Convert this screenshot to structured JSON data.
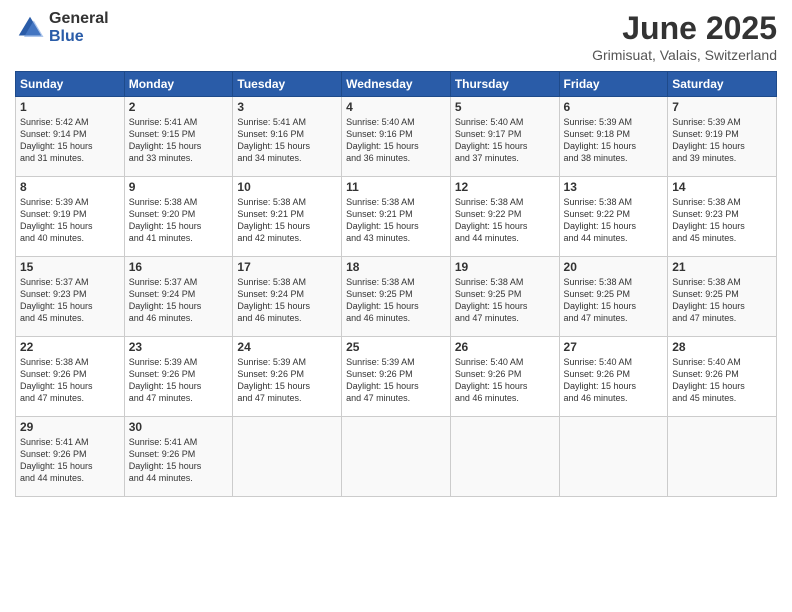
{
  "logo": {
    "general": "General",
    "blue": "Blue"
  },
  "title": {
    "month": "June 2025",
    "location": "Grimisuat, Valais, Switzerland"
  },
  "days_of_week": [
    "Sunday",
    "Monday",
    "Tuesday",
    "Wednesday",
    "Thursday",
    "Friday",
    "Saturday"
  ],
  "weeks": [
    [
      {
        "day": "1",
        "sunrise": "5:42 AM",
        "sunset": "9:14 PM",
        "daylight": "15 hours and 31 minutes."
      },
      {
        "day": "2",
        "sunrise": "5:41 AM",
        "sunset": "9:15 PM",
        "daylight": "15 hours and 33 minutes."
      },
      {
        "day": "3",
        "sunrise": "5:41 AM",
        "sunset": "9:16 PM",
        "daylight": "15 hours and 34 minutes."
      },
      {
        "day": "4",
        "sunrise": "5:40 AM",
        "sunset": "9:16 PM",
        "daylight": "15 hours and 36 minutes."
      },
      {
        "day": "5",
        "sunrise": "5:40 AM",
        "sunset": "9:17 PM",
        "daylight": "15 hours and 37 minutes."
      },
      {
        "day": "6",
        "sunrise": "5:39 AM",
        "sunset": "9:18 PM",
        "daylight": "15 hours and 38 minutes."
      },
      {
        "day": "7",
        "sunrise": "5:39 AM",
        "sunset": "9:19 PM",
        "daylight": "15 hours and 39 minutes."
      }
    ],
    [
      {
        "day": "8",
        "sunrise": "5:39 AM",
        "sunset": "9:19 PM",
        "daylight": "15 hours and 40 minutes."
      },
      {
        "day": "9",
        "sunrise": "5:38 AM",
        "sunset": "9:20 PM",
        "daylight": "15 hours and 41 minutes."
      },
      {
        "day": "10",
        "sunrise": "5:38 AM",
        "sunset": "9:21 PM",
        "daylight": "15 hours and 42 minutes."
      },
      {
        "day": "11",
        "sunrise": "5:38 AM",
        "sunset": "9:21 PM",
        "daylight": "15 hours and 43 minutes."
      },
      {
        "day": "12",
        "sunrise": "5:38 AM",
        "sunset": "9:22 PM",
        "daylight": "15 hours and 44 minutes."
      },
      {
        "day": "13",
        "sunrise": "5:38 AM",
        "sunset": "9:22 PM",
        "daylight": "15 hours and 44 minutes."
      },
      {
        "day": "14",
        "sunrise": "5:38 AM",
        "sunset": "9:23 PM",
        "daylight": "15 hours and 45 minutes."
      }
    ],
    [
      {
        "day": "15",
        "sunrise": "5:37 AM",
        "sunset": "9:23 PM",
        "daylight": "15 hours and 45 minutes."
      },
      {
        "day": "16",
        "sunrise": "5:37 AM",
        "sunset": "9:24 PM",
        "daylight": "15 hours and 46 minutes."
      },
      {
        "day": "17",
        "sunrise": "5:38 AM",
        "sunset": "9:24 PM",
        "daylight": "15 hours and 46 minutes."
      },
      {
        "day": "18",
        "sunrise": "5:38 AM",
        "sunset": "9:25 PM",
        "daylight": "15 hours and 46 minutes."
      },
      {
        "day": "19",
        "sunrise": "5:38 AM",
        "sunset": "9:25 PM",
        "daylight": "15 hours and 47 minutes."
      },
      {
        "day": "20",
        "sunrise": "5:38 AM",
        "sunset": "9:25 PM",
        "daylight": "15 hours and 47 minutes."
      },
      {
        "day": "21",
        "sunrise": "5:38 AM",
        "sunset": "9:25 PM",
        "daylight": "15 hours and 47 minutes."
      }
    ],
    [
      {
        "day": "22",
        "sunrise": "5:38 AM",
        "sunset": "9:26 PM",
        "daylight": "15 hours and 47 minutes."
      },
      {
        "day": "23",
        "sunrise": "5:39 AM",
        "sunset": "9:26 PM",
        "daylight": "15 hours and 47 minutes."
      },
      {
        "day": "24",
        "sunrise": "5:39 AM",
        "sunset": "9:26 PM",
        "daylight": "15 hours and 47 minutes."
      },
      {
        "day": "25",
        "sunrise": "5:39 AM",
        "sunset": "9:26 PM",
        "daylight": "15 hours and 47 minutes."
      },
      {
        "day": "26",
        "sunrise": "5:40 AM",
        "sunset": "9:26 PM",
        "daylight": "15 hours and 46 minutes."
      },
      {
        "day": "27",
        "sunrise": "5:40 AM",
        "sunset": "9:26 PM",
        "daylight": "15 hours and 46 minutes."
      },
      {
        "day": "28",
        "sunrise": "5:40 AM",
        "sunset": "9:26 PM",
        "daylight": "15 hours and 45 minutes."
      }
    ],
    [
      {
        "day": "29",
        "sunrise": "5:41 AM",
        "sunset": "9:26 PM",
        "daylight": "15 hours and 44 minutes."
      },
      {
        "day": "30",
        "sunrise": "5:41 AM",
        "sunset": "9:26 PM",
        "daylight": "15 hours and 44 minutes."
      },
      {
        "day": "",
        "sunrise": "",
        "sunset": "",
        "daylight": ""
      },
      {
        "day": "",
        "sunrise": "",
        "sunset": "",
        "daylight": ""
      },
      {
        "day": "",
        "sunrise": "",
        "sunset": "",
        "daylight": ""
      },
      {
        "day": "",
        "sunrise": "",
        "sunset": "",
        "daylight": ""
      },
      {
        "day": "",
        "sunrise": "",
        "sunset": "",
        "daylight": ""
      }
    ]
  ]
}
